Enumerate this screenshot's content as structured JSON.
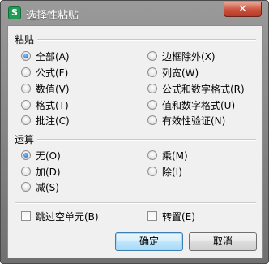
{
  "window": {
    "title": "选择性粘贴",
    "app_icon_letter": "S",
    "close_glyph": "✕"
  },
  "paste_group": {
    "title": "粘贴",
    "left_options": [
      {
        "label": "全部(A)",
        "selected": true
      },
      {
        "label": "公式(F)",
        "selected": false
      },
      {
        "label": "数值(V)",
        "selected": false
      },
      {
        "label": "格式(T)",
        "selected": false
      },
      {
        "label": "批注(C)",
        "selected": false
      }
    ],
    "right_options": [
      {
        "label": "边框除外(X)",
        "selected": false
      },
      {
        "label": "列宽(W)",
        "selected": false
      },
      {
        "label": "公式和数字格式(R)",
        "selected": false
      },
      {
        "label": "值和数字格式(U)",
        "selected": false
      },
      {
        "label": "有效性验证(N)",
        "selected": false
      }
    ]
  },
  "operation_group": {
    "title": "运算",
    "left_options": [
      {
        "label": "无(O)",
        "selected": true
      },
      {
        "label": "加(D)",
        "selected": false
      },
      {
        "label": "减(S)",
        "selected": false
      }
    ],
    "right_options": [
      {
        "label": "乘(M)",
        "selected": false
      },
      {
        "label": "除(I)",
        "selected": false
      }
    ]
  },
  "checkboxes": {
    "skip_blanks": {
      "label": "跳过空单元(B)",
      "checked": false
    },
    "transpose": {
      "label": "转置(E)",
      "checked": false
    }
  },
  "buttons": {
    "ok": "确定",
    "cancel": "取消"
  }
}
